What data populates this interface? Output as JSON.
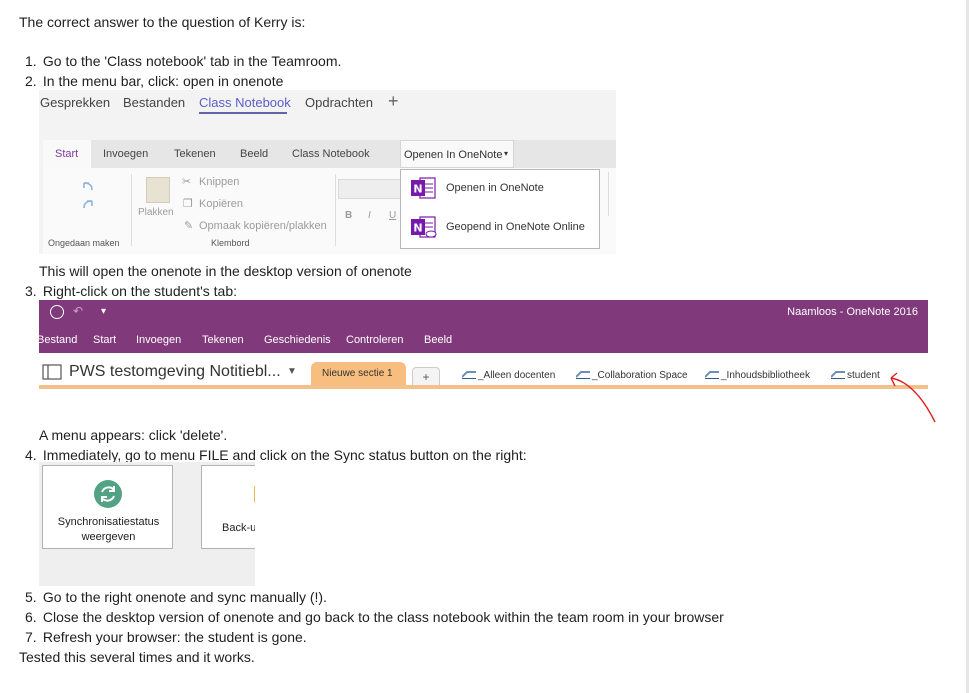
{
  "intro": "The correct answer to the question of Kerry is:",
  "steps": {
    "s1": {
      "num": "1.",
      "text": "Go to the 'Class notebook' tab in the Teamroom."
    },
    "s2": {
      "num": "2.",
      "text": "In the menu bar, click: open in onenote"
    },
    "s2_note": "This will open the onenote in the desktop version of onenote",
    "s3": {
      "num": "3.",
      "text": "Right-click on the student's tab:"
    },
    "s3_note": "A menu appears: click 'delete'.",
    "s4": {
      "num": "4.",
      "text": "Immediately, go to menu FILE and click on the Sync status button on the right:"
    },
    "s5": {
      "num": "5.",
      "text": "Go to the right onenote and sync manually (!)."
    },
    "s6": {
      "num": "6.",
      "text": "Close the desktop version of onenote and go back to the class notebook within the team room in your browser"
    },
    "s7": {
      "num": "7.",
      "text": "Refresh your browser: the student is gone."
    }
  },
  "closing": "Tested this several times and it works.",
  "shot1": {
    "tabs": [
      "Gesprekken",
      "Bestanden",
      "Class Notebook",
      "Opdrachten"
    ],
    "add_tab": "+",
    "ribbon_tabs": [
      "Start",
      "Invoegen",
      "Tekenen",
      "Beeld",
      "Class Notebook"
    ],
    "open_in_onenote": "Openen In OneNote",
    "undo_group": "Ongedaan maken",
    "paste": "Plakken",
    "cut": "Knippen",
    "copy": "Kopiëren",
    "format_painter": "Opmaak kopiëren/plakken",
    "clipboard_group": "Klembord",
    "bold": "B",
    "italic": "I",
    "underline": "U",
    "dropdown": [
      "Openen in OneNote",
      "Geopend in OneNote Online"
    ],
    "icon_letter": "N"
  },
  "shot2": {
    "window_title": "Naamloos - OneNote 2016",
    "menu": [
      "Bestand",
      "Start",
      "Invoegen",
      "Tekenen",
      "Geschiedenis",
      "Controleren",
      "Beeld"
    ],
    "notebook": "PWS testomgeving Notitiebl...",
    "active_section": "Nieuwe sectie 1",
    "add_section": "+",
    "groups": [
      "_Alleen docenten",
      "_Collaboration Space",
      "_Inhoudsbibliotheek",
      "student"
    ],
    "colors": {
      "titlebar": "#80397b",
      "section": "#f7be80",
      "annotation": "#e02020"
    }
  },
  "shot3": {
    "sync_line1": "Synchronisatiestatus",
    "sync_line2": "weergeven",
    "backup_partial": "Back-u"
  }
}
